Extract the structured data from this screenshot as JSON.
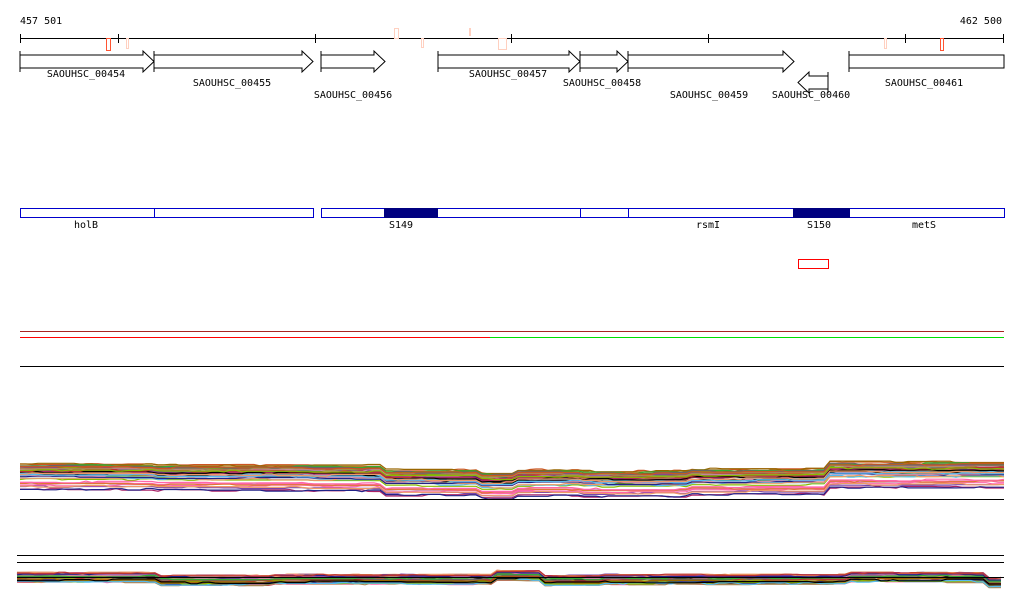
{
  "ruler": {
    "start_label": "457 501",
    "end_label": "462 500"
  },
  "genes": [
    {
      "id": "SAOUHSC_00454",
      "strand": "+"
    },
    {
      "id": "SAOUHSC_00455",
      "strand": "+"
    },
    {
      "id": "SAOUHSC_00456",
      "strand": "+"
    },
    {
      "id": "SAOUHSC_00457",
      "strand": "+"
    },
    {
      "id": "SAOUHSC_00458",
      "strand": "+"
    },
    {
      "id": "SAOUHSC_00459",
      "strand": "+"
    },
    {
      "id": "SAOUHSC_00460",
      "strand": "-"
    },
    {
      "id": "SAOUHSC_00461",
      "strand": "+"
    }
  ],
  "annotations": [
    "holB",
    "S149",
    "rsmI",
    "S150",
    "metS"
  ],
  "colors": {
    "feature": "#0000cc",
    "feature_fill": "#000080",
    "marker": "#ff3300",
    "marker_pale": "#ffd0c0",
    "track_red": "#ff0000",
    "track_green": "#00dd00"
  }
}
